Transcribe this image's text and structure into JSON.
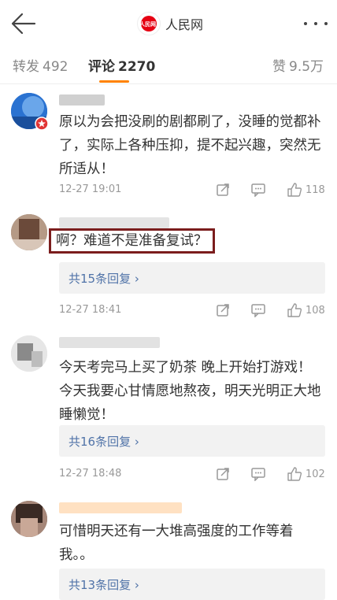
{
  "header": {
    "logo_text": "人民网",
    "title": "人民网"
  },
  "tabs": [
    {
      "label": "转发",
      "count": "492"
    },
    {
      "label": "评论",
      "count": "2270"
    },
    {
      "label": "赞",
      "count": "9.5万"
    }
  ],
  "comments": [
    {
      "text": "原以为会把没刷的剧都刷了，没睡的觉都补了，实际上各种压抑，提不起兴趣，突然无所适从！",
      "time": "12-27 19:01",
      "likes": "118"
    },
    {
      "text": "啊？难道不是准备复试？",
      "replies": "共15条回复",
      "time": "12-27 18:41",
      "likes": "108"
    },
    {
      "text": "今天考完马上买了奶茶 晚上开始打游戏！今天我要心甘情愿地熬夜，明天光明正大地睡懒觉！",
      "replies": "共16条回复",
      "time": "12-27 18:48",
      "likes": "102"
    },
    {
      "text": "可惜明天还有一大堆高强度的工作等着我。。",
      "replies": "共13条回复"
    }
  ],
  "colors": {
    "accent": "#ff8200",
    "link": "#5073a8",
    "highlight_box": "#7b1d1d"
  }
}
